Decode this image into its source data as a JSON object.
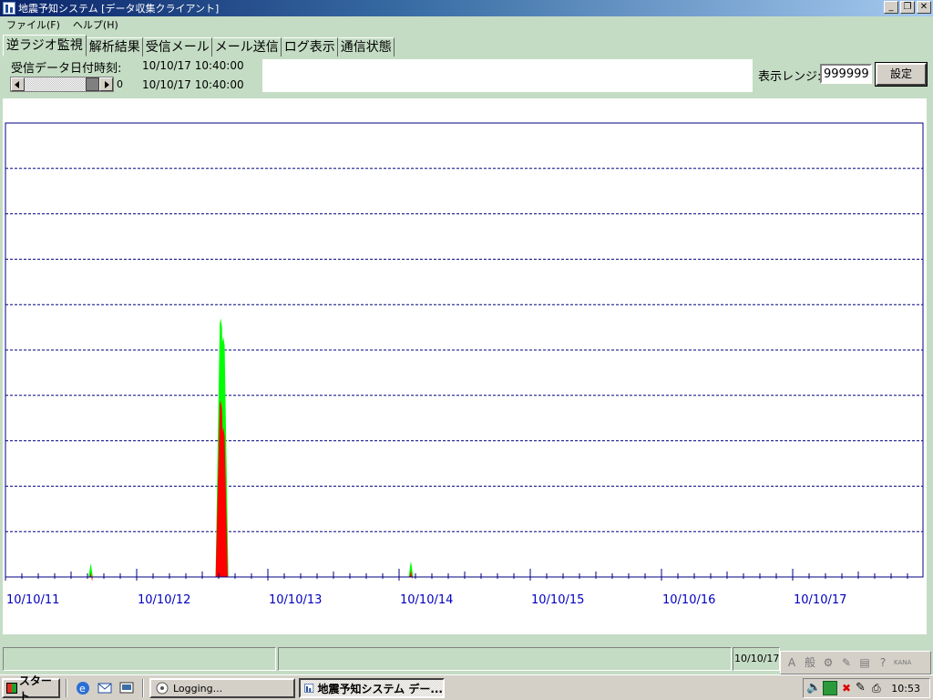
{
  "window": {
    "title": "地震予知システム [データ収集クライアント]",
    "minimize": "_",
    "restore": "❐",
    "close": "✕"
  },
  "menu": [
    "ファイル(F)",
    "ヘルプ(H)"
  ],
  "tabs": [
    "逆ラジオ監視",
    "解析結果",
    "受信メール",
    "メール送信",
    "ログ表示",
    "通信状態"
  ],
  "info": {
    "recv_label": "受信データ日付時刻:",
    "recv_datetime": "10/10/17 10:40:00",
    "scroll_value": "0",
    "recv_datetime2": "10/10/17 10:40:00"
  },
  "range": {
    "label": "表示レンジ:",
    "value": "999999",
    "set_button": "設定"
  },
  "chart_data": {
    "type": "area",
    "x_labels": [
      "10/10/11",
      "10/10/12",
      "10/10/13",
      "10/10/14",
      "10/10/15",
      "10/10/16",
      "10/10/17"
    ],
    "ylim": [
      0,
      10
    ],
    "grid": true,
    "series": [
      {
        "color": "#00ff00",
        "points": [
          [
            0.65,
            0.3
          ],
          [
            1.64,
            5.7
          ],
          [
            1.66,
            5.3
          ],
          [
            3.09,
            0.35
          ]
        ]
      },
      {
        "color": "#ff0000",
        "points": [
          [
            0.65,
            0.1
          ],
          [
            1.64,
            3.9
          ],
          [
            1.66,
            3.3
          ],
          [
            3.09,
            0.15
          ]
        ]
      }
    ]
  },
  "status": {
    "clock": "10/10/17"
  },
  "ime": [
    "般",
    "KANA"
  ],
  "taskbar": {
    "start": "スタート",
    "tasks": [
      "Logging...",
      "地震予知システム デー..."
    ],
    "clock": "10:53"
  }
}
